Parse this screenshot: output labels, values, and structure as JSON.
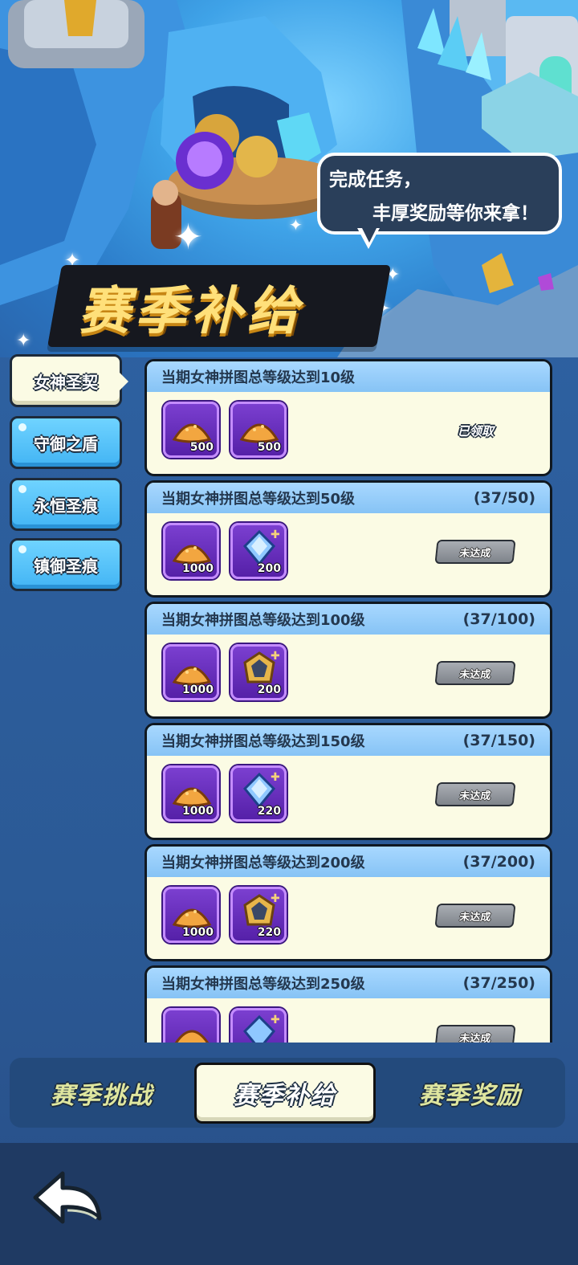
{
  "header": {
    "speech_line1": "完成任务，",
    "speech_line2": "丰厚奖励等你来拿！",
    "title": "赛季补给"
  },
  "side_tabs": [
    {
      "label": "女神圣契",
      "active": true
    },
    {
      "label": "守御之盾",
      "active": false
    },
    {
      "label": "永恒圣痕",
      "active": false
    },
    {
      "label": "镇御圣痕",
      "active": false
    }
  ],
  "tasks": [
    {
      "title": "当期女神拼图总等级达到10级",
      "progress": "",
      "status": "已领取",
      "rewards": [
        {
          "icon": "gold-pile-icon",
          "count": "500"
        },
        {
          "icon": "gold-pile-icon",
          "count": "500"
        }
      ]
    },
    {
      "title": "当期女神拼图总等级达到50级",
      "progress": "(37/50)",
      "status": "未达成",
      "rewards": [
        {
          "icon": "gold-pile-icon",
          "count": "1000"
        },
        {
          "icon": "blue-crystal-icon",
          "count": "200"
        }
      ]
    },
    {
      "title": "当期女神拼图总等级达到100级",
      "progress": "(37/100)",
      "status": "未达成",
      "rewards": [
        {
          "icon": "gold-pile-icon",
          "count": "1000"
        },
        {
          "icon": "dark-gem-icon",
          "count": "200"
        }
      ]
    },
    {
      "title": "当期女神拼图总等级达到150级",
      "progress": "(37/150)",
      "status": "未达成",
      "rewards": [
        {
          "icon": "gold-pile-icon",
          "count": "1000"
        },
        {
          "icon": "blue-crystal-icon",
          "count": "220"
        }
      ]
    },
    {
      "title": "当期女神拼图总等级达到200级",
      "progress": "(37/200)",
      "status": "未达成",
      "rewards": [
        {
          "icon": "gold-pile-icon",
          "count": "1000"
        },
        {
          "icon": "dark-gem-icon",
          "count": "220"
        }
      ]
    },
    {
      "title": "当期女神拼图总等级达到250级",
      "progress": "(37/250)",
      "status": "未达成",
      "rewards": [
        {
          "icon": "gold-pile-icon",
          "count": ""
        },
        {
          "icon": "blue-crystal-icon",
          "count": ""
        }
      ]
    }
  ],
  "bottom_tabs": [
    {
      "label": "赛季挑战",
      "active": false
    },
    {
      "label": "赛季补给",
      "active": true
    },
    {
      "label": "赛季奖励",
      "active": false
    }
  ],
  "colors": {
    "card_bg": "#fbfbe4",
    "card_header": "#86c3f5",
    "item_bg": "#5520a8",
    "accent_title": "#ffe07a"
  },
  "icons": {
    "back": "back-arrow-icon",
    "sparkle": "sparkle-icon"
  }
}
